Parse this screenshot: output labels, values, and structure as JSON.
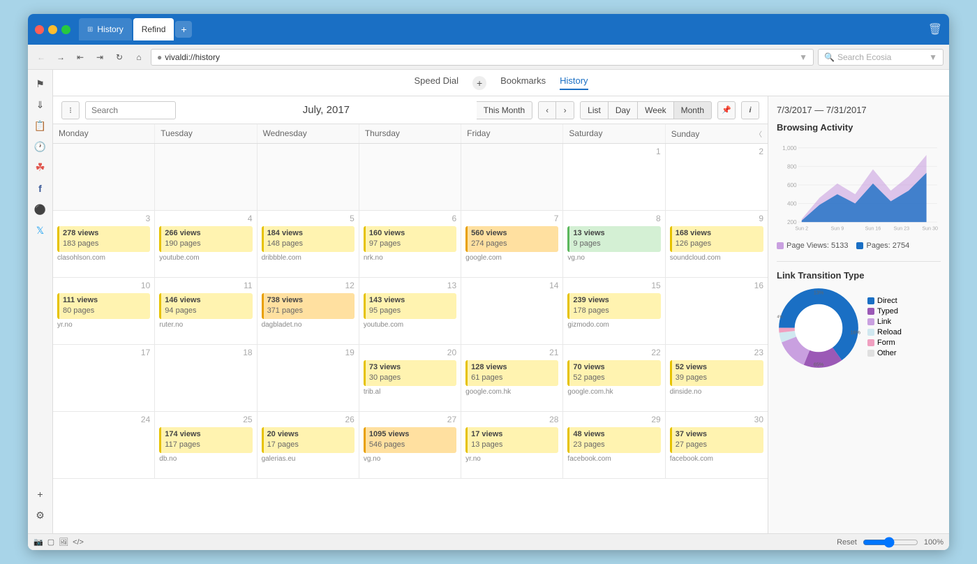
{
  "browser": {
    "tabs": [
      {
        "id": "history",
        "label": "History",
        "active": false,
        "icon": "⊞"
      },
      {
        "id": "refind",
        "label": "Refind",
        "active": true,
        "icon": ""
      },
      {
        "id": "new",
        "label": "+",
        "active": false
      }
    ],
    "url": "vivaldi://history",
    "search_placeholder": "Search Ecosia"
  },
  "nav_tabs": [
    {
      "id": "speed-dial",
      "label": "Speed Dial"
    },
    {
      "id": "bookmarks",
      "label": "Bookmarks"
    },
    {
      "id": "history",
      "label": "History",
      "active": true
    }
  ],
  "toolbar": {
    "search_placeholder": "Search",
    "month_title": "July, 2017",
    "this_month": "This Month",
    "view_modes": [
      "List",
      "Day",
      "Week",
      "Month"
    ],
    "active_view": "Month"
  },
  "calendar": {
    "headers": [
      "Monday",
      "Tuesday",
      "Wednesday",
      "Thursday",
      "Friday",
      "Saturday",
      "Sunday"
    ],
    "week1": [
      {
        "date": "",
        "empty": true
      },
      {
        "date": "",
        "empty": true
      },
      {
        "date": "",
        "empty": true
      },
      {
        "date": "",
        "empty": true
      },
      {
        "date": "",
        "empty": true
      },
      {
        "date": "1",
        "events": []
      },
      {
        "date": "2",
        "events": []
      }
    ],
    "week2": [
      {
        "date": "3",
        "events": [
          {
            "type": "yellow",
            "views": "278 views",
            "pages": "183 pages"
          },
          {
            "domain": "clasohlson.com"
          }
        ]
      },
      {
        "date": "4",
        "events": [
          {
            "type": "yellow",
            "views": "266 views",
            "pages": "190 pages"
          },
          {
            "domain": "youtube.com"
          }
        ]
      },
      {
        "date": "5",
        "events": [
          {
            "type": "yellow",
            "views": "184 views",
            "pages": "148 pages"
          },
          {
            "domain": "dribbble.com"
          }
        ]
      },
      {
        "date": "6",
        "events": [
          {
            "type": "yellow",
            "views": "160 views",
            "pages": "97 pages"
          },
          {
            "domain": "nrk.no"
          }
        ]
      },
      {
        "date": "7",
        "events": [
          {
            "type": "orange",
            "views": "560 views",
            "pages": "274 pages"
          },
          {
            "domain": "google.com"
          }
        ]
      },
      {
        "date": "8",
        "events": [
          {
            "type": "green",
            "views": "13 views",
            "pages": "9 pages"
          },
          {
            "domain": "vg.no"
          }
        ]
      },
      {
        "date": "9",
        "events": [
          {
            "type": "yellow",
            "views": "168 views",
            "pages": "126 pages"
          },
          {
            "domain": "soundcloud.com"
          }
        ]
      }
    ],
    "week3": [
      {
        "date": "10",
        "events": [
          {
            "type": "yellow",
            "views": "111 views",
            "pages": "80 pages"
          },
          {
            "domain": "yr.no"
          }
        ]
      },
      {
        "date": "11",
        "events": [
          {
            "type": "yellow",
            "views": "146 views",
            "pages": "94 pages"
          },
          {
            "domain": "ruter.no"
          }
        ]
      },
      {
        "date": "12",
        "events": [
          {
            "type": "orange",
            "views": "738 views",
            "pages": "371 pages"
          },
          {
            "domain": "dagbladet.no"
          }
        ]
      },
      {
        "date": "13",
        "events": [
          {
            "type": "yellow",
            "views": "143 views",
            "pages": "95 pages"
          },
          {
            "domain": "youtube.com"
          }
        ]
      },
      {
        "date": "14",
        "events": []
      },
      {
        "date": "15",
        "events": [
          {
            "type": "yellow",
            "views": "239 views",
            "pages": "178 pages"
          },
          {
            "domain": "gizmodo.com"
          }
        ]
      },
      {
        "date": "16",
        "events": []
      }
    ],
    "week4": [
      {
        "date": "17",
        "events": []
      },
      {
        "date": "18",
        "events": []
      },
      {
        "date": "19",
        "events": []
      },
      {
        "date": "20",
        "events": [
          {
            "type": "yellow",
            "views": "73 views",
            "pages": "30 pages"
          },
          {
            "domain": "trib.al"
          }
        ]
      },
      {
        "date": "21",
        "events": [
          {
            "type": "yellow",
            "views": "128 views",
            "pages": "61 pages"
          },
          {
            "domain": "google.com.hk"
          }
        ]
      },
      {
        "date": "22",
        "events": [
          {
            "type": "yellow",
            "views": "70 views",
            "pages": "52 pages"
          },
          {
            "domain": "google.com.hk"
          }
        ]
      },
      {
        "date": "23",
        "events": [
          {
            "type": "yellow",
            "views": "52 views",
            "pages": "39 pages"
          },
          {
            "domain": "dinside.no"
          }
        ]
      }
    ],
    "week5": [
      {
        "date": "24",
        "events": []
      },
      {
        "date": "25",
        "events": [
          {
            "type": "yellow",
            "views": "174 views",
            "pages": "117 pages"
          },
          {
            "domain": "db.no"
          }
        ]
      },
      {
        "date": "26",
        "events": [
          {
            "type": "yellow",
            "views": "20 views",
            "pages": "17 pages"
          },
          {
            "domain": "galerias.eu"
          }
        ]
      },
      {
        "date": "27",
        "events": [
          {
            "type": "orange",
            "views": "1095 views",
            "pages": "546 pages"
          },
          {
            "domain": "vg.no"
          }
        ]
      },
      {
        "date": "28",
        "events": [
          {
            "type": "yellow",
            "views": "17 views",
            "pages": "13 pages"
          },
          {
            "domain": "yr.no"
          }
        ]
      },
      {
        "date": "29",
        "events": [
          {
            "type": "yellow",
            "views": "48 views",
            "pages": "23 pages"
          },
          {
            "domain": "facebook.com"
          }
        ]
      },
      {
        "date": "30",
        "events": [
          {
            "type": "yellow",
            "views": "37 views",
            "pages": "27 pages"
          },
          {
            "domain": "facebook.com"
          }
        ]
      }
    ]
  },
  "right_panel": {
    "date_range": "7/3/2017 — 7/31/2017",
    "browsing_activity_title": "Browsing Activity",
    "chart_y_labels": [
      "1,000",
      "800",
      "600",
      "400",
      "200"
    ],
    "chart_x_labels": [
      "Sun 2",
      "Sun 9",
      "Sun 16",
      "Sun 23",
      "Sun 30"
    ],
    "legend_page_views": "Page Views: 5133",
    "legend_pages": "Pages: 2754",
    "transition_title": "Link Transition Type",
    "donut_segments": [
      {
        "label": "Direct",
        "color": "#1a6fc4",
        "pct": 65
      },
      {
        "label": "Typed",
        "color": "#9b59b6",
        "pct": 16
      },
      {
        "label": "Link",
        "color": "#c9a0e0",
        "pct": 13
      },
      {
        "label": "Reload",
        "color": "#d0e8f0",
        "pct": 4
      },
      {
        "label": "Form",
        "color": "#f0a0c0",
        "pct": 2
      },
      {
        "label": "Other",
        "color": "#e0e0e0",
        "pct": 0
      }
    ],
    "donut_labels": {
      "pct_13": "13%",
      "pct_16": "16%",
      "pct_2_4": "2  4%",
      "pct_65": "65%"
    }
  },
  "status_bar": {
    "zoom": "100%",
    "reset": "Reset"
  }
}
